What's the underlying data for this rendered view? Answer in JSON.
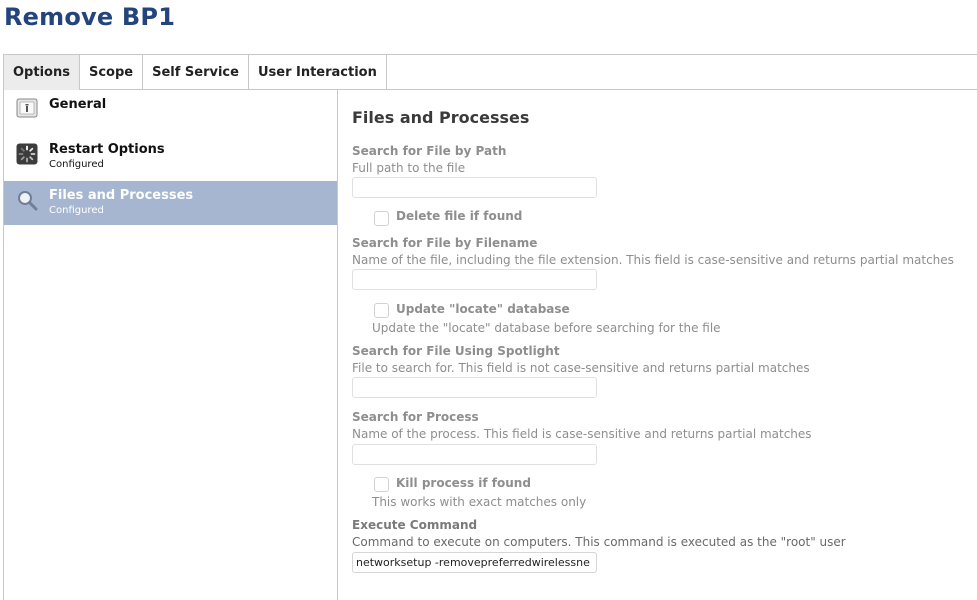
{
  "page": {
    "title": "Remove BP1"
  },
  "tabs": [
    {
      "label": "Options",
      "active": true
    },
    {
      "label": "Scope"
    },
    {
      "label": "Self Service"
    },
    {
      "label": "User Interaction"
    }
  ],
  "sidebar": {
    "items": [
      {
        "label": "General",
        "status": "",
        "icon": "general-icon"
      },
      {
        "label": "Restart Options",
        "status": "Configured",
        "icon": "restart-options-icon"
      },
      {
        "label": "Files and Processes",
        "status": "Configured",
        "icon": "magnifier-icon",
        "selected": true
      }
    ]
  },
  "main": {
    "section_title": "Files and Processes",
    "search_path": {
      "title": "Search for File by Path",
      "desc": "Full path to the file",
      "value": ""
    },
    "delete_file": {
      "label": "Delete file if found",
      "checked": false
    },
    "search_filename": {
      "title": "Search for File by Filename",
      "desc": "Name of the file, including the file extension. This field is case-sensitive and returns partial matches",
      "value": ""
    },
    "update_locate": {
      "label": "Update \"locate\" database",
      "help": "Update the \"locate\" database before searching for the file",
      "checked": false
    },
    "search_spotlight": {
      "title": "Search for File Using Spotlight",
      "desc": "File to search for. This field is not case-sensitive and returns partial matches",
      "value": ""
    },
    "search_process": {
      "title": "Search for Process",
      "desc": "Name of the process. This field is case-sensitive and returns partial matches",
      "value": ""
    },
    "kill_process": {
      "label": "Kill process if found",
      "help": "This works with exact matches only",
      "checked": false
    },
    "execute_command": {
      "title": "Execute Command",
      "desc": "Command to execute on computers. This command is executed as the \"root\" user",
      "value": "networksetup -removepreferredwirelessne"
    }
  },
  "colors": {
    "title": "#24447e",
    "selection": "#a6b6d0",
    "muted_text": "#8e8e8e"
  }
}
